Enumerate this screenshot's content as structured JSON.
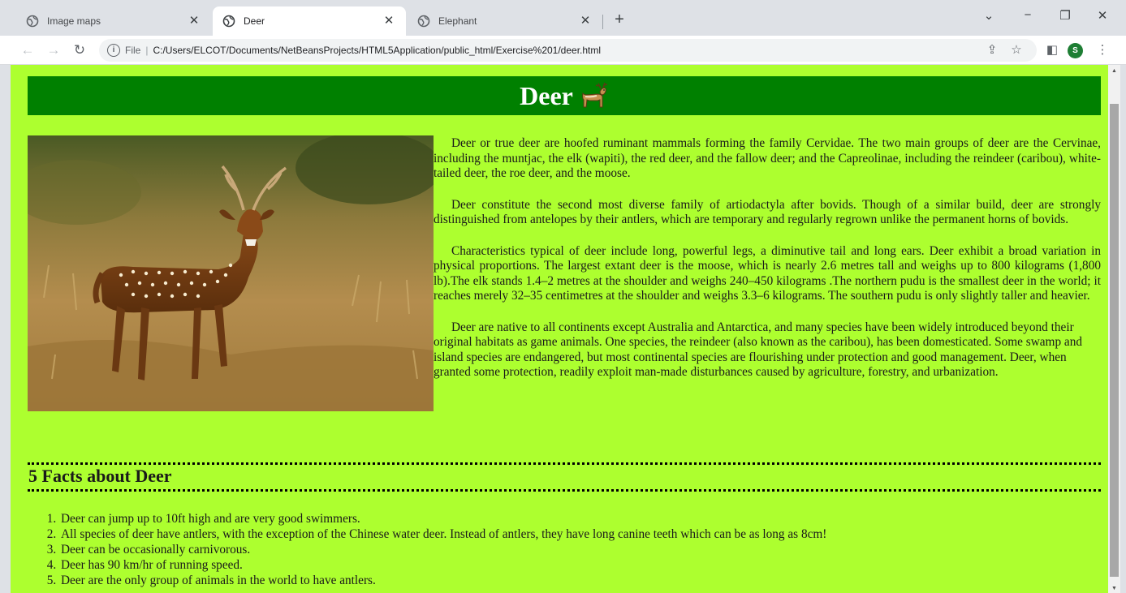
{
  "browser": {
    "tabs": [
      {
        "label": "Image maps",
        "active": false
      },
      {
        "label": "Deer",
        "active": true
      },
      {
        "label": "Elephant",
        "active": false
      }
    ],
    "url_scheme": "File",
    "url": "C:/Users/ELCOT/Documents/NetBeansProjects/HTML5Application/public_html/Exercise%201/deer.html",
    "profile_initial": "S"
  },
  "page": {
    "heading": "Deer",
    "paragraphs": [
      "Deer or true deer are hoofed ruminant mammals forming the family Cervidae. The two main groups of deer are the Cervinae, including the muntjac, the elk (wapiti), the red deer, and the fallow deer; and the Capreolinae, including the reindeer (caribou), white-tailed deer, the roe deer, and the moose.",
      "Deer constitute the second most diverse family of artiodactyla after bovids. Though of a similar build, deer are strongly distinguished from antelopes by their antlers, which are temporary and regularly regrown unlike the permanent horns of bovids.",
      "Characteristics typical of deer include long, powerful legs, a diminutive tail and long ears. Deer exhibit a broad variation in physical proportions. The largest extant deer is the moose, which is nearly 2.6 metres tall and weighs up to 800 kilograms (1,800 lb).The elk stands 1.4–2 metres at the shoulder and weighs 240–450 kilograms .The northern pudu is the smallest deer in the world; it reaches merely 32–35 centimetres at the shoulder and weighs 3.3–6 kilograms. The southern pudu is only slightly taller and heavier.",
      "Deer are native to all continents except Australia and Antarctica, and many species have been widely introduced beyond their original habitats as game animals. One species, the reindeer (also known as the caribou), has been domesticated. Some swamp and island species are endangered, but most continental species are flourishing under protection and good management. Deer, when granted some protection, readily exploit man-made disturbances caused by agriculture, forestry, and urbanization."
    ],
    "facts_title": "5 Facts about Deer",
    "facts": [
      "Deer can jump up to 10ft high and are very good swimmers.",
      "All species of deer have antlers, with the exception of the Chinese water deer. Instead of antlers, they have long canine teeth which can be as long as 8cm!",
      "Deer can be occasionally carnivorous.",
      "Deer has 90 km/hr of running speed.",
      "Deer are the only group of animals in the world to have antlers."
    ]
  },
  "colors": {
    "page_background": "#adff2f",
    "heading_background": "#008000",
    "heading_text": "#ffffff"
  }
}
